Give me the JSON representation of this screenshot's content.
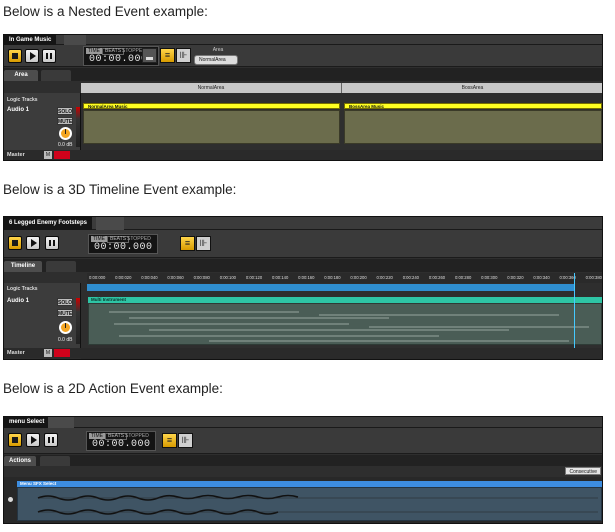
{
  "captions": {
    "nested": "Below is a Nested Event example:",
    "timeline3d": "Below is a 3D Timeline Event example:",
    "action2d": "Below is a 2D Action Event example:"
  },
  "colors": {
    "transport_yellow": "#f5b800",
    "nested_instrument": "#ffff22",
    "multi_instrument": "#2ec5a5",
    "action_instrument": "#3d8de0",
    "record_red": "#d0021b"
  },
  "common": {
    "time_label": "TIME",
    "beats_label": "BEATS",
    "stopped_label": "STOPPED",
    "time_value": "00:00.000",
    "logic_tracks": "Logic Tracks",
    "audio_track": "Audio 1",
    "solo": "SOLO",
    "mute": "MUTE",
    "db_value": "0.0 dB",
    "master": "Master",
    "m_btn": "M"
  },
  "nested": {
    "tab": "In Game Music",
    "subtab": "Area",
    "param_label": "Area",
    "param_value": "NormalArea",
    "regions": [
      "NormalArea",
      "BossArea"
    ],
    "instruments": [
      "NormalArea Music",
      "BossArea Music"
    ]
  },
  "timeline3d": {
    "tab": "6 Legged Enemy Footsteps",
    "subtab": "Timeline",
    "instrument": "Multi Instrument",
    "ticks": [
      "0:00:000",
      "0:00:020",
      "0:00:040",
      "0:00:060",
      "0:00:080",
      "0:00:100",
      "0:00:120",
      "0:00:140",
      "0:00:160",
      "0:00:180",
      "0:00:200",
      "0:00:220",
      "0:00:240",
      "0:00:260",
      "0:00:280",
      "0:00:300",
      "0:00:320",
      "0:00:340",
      "0:00:360",
      "0:00:380"
    ]
  },
  "action2d": {
    "tab": "menu Select",
    "subtab": "Actions",
    "mode": "Consecutive",
    "instrument": "Menu SFX Select"
  }
}
